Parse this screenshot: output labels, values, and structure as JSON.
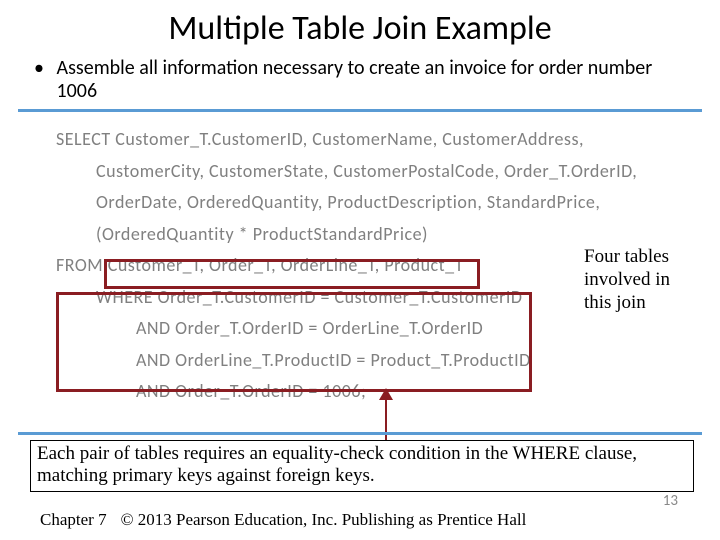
{
  "title": "Multiple Table Join Example",
  "bullet": "Assemble all information necessary to create an invoice for order number 1006",
  "sql": {
    "select": "SELECT Customer_T.CustomerID, CustomerName, CustomerAddress,",
    "line2": "CustomerCity, CustomerState, CustomerPostalCode, Order_T.OrderID,",
    "line3": "OrderDate, OrderedQuantity, ProductDescription, StandardPrice,",
    "line4": "(OrderedQuantity * ProductStandardPrice)",
    "from": "FROM Customer_T, Order_T, OrderLine_T, Product_T",
    "where1": "WHERE Order_T.CustomerID = Customer_T.CustomerID",
    "where2": "AND Order_T.OrderID = OrderLine_T.OrderID",
    "where3": "AND OrderLine_T.ProductID = Product_T.ProductID",
    "where4": "AND Order_T.OrderID = 1006;"
  },
  "note_right": "Four tables involved in this join",
  "note_bottom": "Each pair of tables requires an equality-check condition in the WHERE clause, matching primary keys against foreign keys.",
  "footer_chapter": "Chapter 7",
  "footer_copy": "© 2013 Pearson Education, Inc.  Publishing as Prentice Hall",
  "page_num": "13"
}
